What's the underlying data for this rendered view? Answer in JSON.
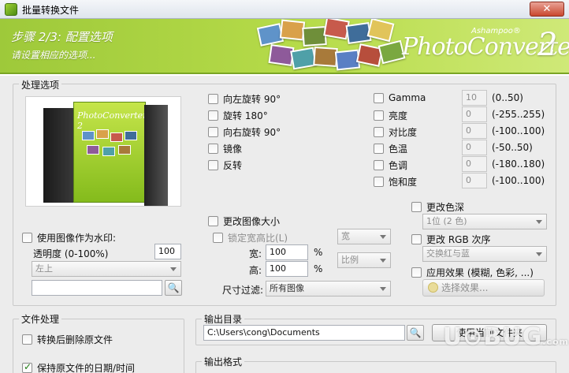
{
  "window": {
    "title": "批量转换文件",
    "close_label": "✕"
  },
  "banner": {
    "step": "步骤 2/3: 配置选项",
    "subtitle": "请设置相应的选项...",
    "brand": "Ashampoo®",
    "product": "PhotoConverter",
    "version": "2",
    "accent": "#9ec93a"
  },
  "processing": {
    "legend": "处理选项",
    "preview_text": "PhotoConverter 2",
    "transforms": [
      {
        "label": "向左旋转 90°",
        "checked": false
      },
      {
        "label": "旋转 180°",
        "checked": false
      },
      {
        "label": "向右旋转 90°",
        "checked": false
      },
      {
        "label": "镜像",
        "checked": false
      },
      {
        "label": "反转",
        "checked": false
      }
    ],
    "adjustments": [
      {
        "label": "Gamma",
        "value": "10",
        "range": "(0..50)"
      },
      {
        "label": "亮度",
        "value": "0",
        "range": "(-255..255)"
      },
      {
        "label": "对比度",
        "value": "0",
        "range": "(-100..100)"
      },
      {
        "label": "色温",
        "value": "0",
        "range": "(-50..50)"
      },
      {
        "label": "色调",
        "value": "0",
        "range": "(-180..180)"
      },
      {
        "label": "饱和度",
        "value": "0",
        "range": "(-100..100)"
      }
    ],
    "resize": {
      "label": "更改图像大小",
      "keep_ratio": "锁定宽高比(L)",
      "ratio_select": "宽",
      "width_label": "宽:",
      "width_value": "100",
      "height_label": "高:",
      "height_value": "100",
      "unit": "%",
      "unit_select": "比例",
      "filter_label": "尺寸过滤:",
      "filter_value": "所有图像"
    },
    "watermark": {
      "label": "使用图像作为水印:",
      "opacity_label": "透明度 (0-100%)",
      "opacity_value": "100",
      "position": "左上",
      "path": ""
    },
    "color_depth": {
      "label": "更改色深",
      "value": "1位 (2 色)"
    },
    "rgb_order": {
      "label": "更改 RGB 次序",
      "value": "交换红与蓝"
    },
    "effects": {
      "label": "应用效果 (模糊, 色彩, ...)",
      "button": "选择效果..."
    }
  },
  "file_processing": {
    "legend": "文件处理",
    "delete_original": {
      "label": "转换后删除原文件",
      "checked": false
    },
    "keep_date": {
      "label": "保持原文件的日期/时间",
      "checked": true
    }
  },
  "output_dir": {
    "legend": "输出目录",
    "path": "C:\\Users\\cong\\Documents",
    "use_current_button": "使用当前文件夹"
  },
  "output_format": {
    "legend": "输出格式"
  },
  "site_watermark": {
    "text": "U⊙BUG",
    "suffix": ".com"
  }
}
